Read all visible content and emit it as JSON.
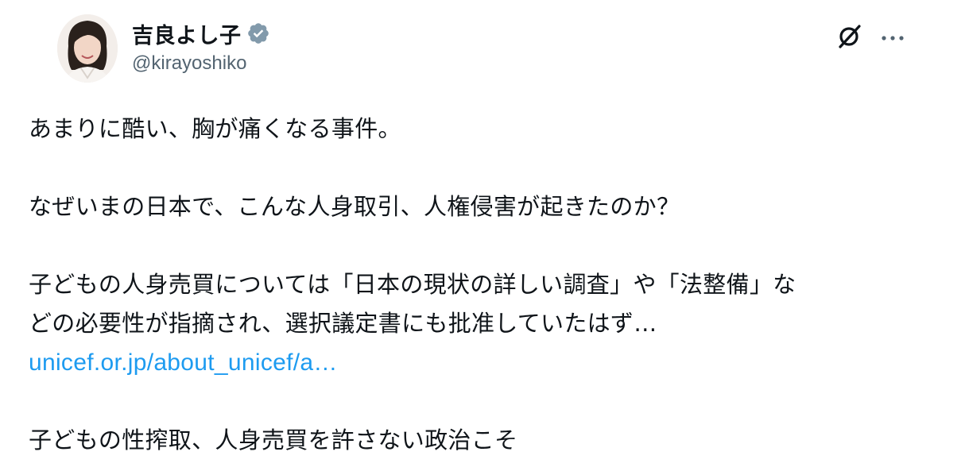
{
  "author": {
    "display_name": "吉良よし子",
    "handle": "@kirayoshiko",
    "verified_color": "#829aab"
  },
  "actions": {
    "grok_icon": "grok-icon",
    "more_icon": "more-icon"
  },
  "tweet": {
    "line1": "あまりに酷い、胸が痛くなる事件。",
    "line2": "なぜいまの日本で、こんな人身取引、人権侵害が起きたのか？",
    "line3a": "子どもの人身売買については「日本の現状の詳しい調査」や「法整備」な",
    "line3b": "どの必要性が指摘され、選択議定書にも批准していたはず…",
    "link_text": "unicef.or.jp/about_unicef/a…",
    "line4": "子どもの性搾取、人身売買を許さない政治こそ"
  },
  "colors": {
    "text": "#0f1419",
    "secondary": "#536471",
    "link": "#1d9bf0"
  }
}
